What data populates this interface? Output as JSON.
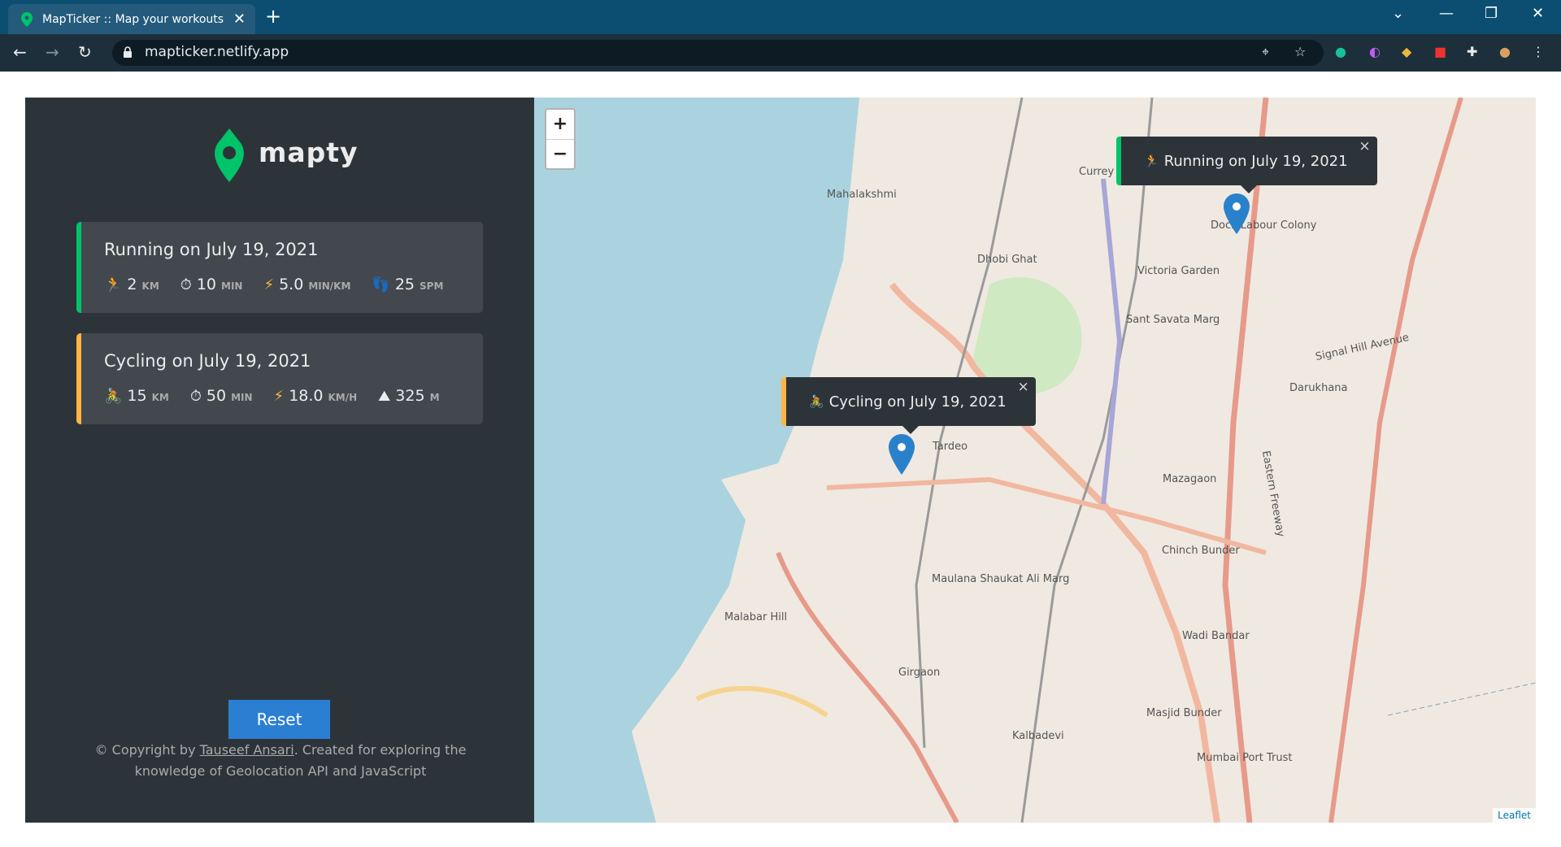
{
  "browser": {
    "tab_title": "MapTicker :: Map your workouts",
    "url": "mapticker.netlify.app"
  },
  "sidebar": {
    "brand": "mapty",
    "workouts": [
      {
        "title": "Running on July 19, 2021",
        "type": "running",
        "accent": "#00c46a",
        "stats": [
          {
            "icon": "running-icon",
            "value": "2",
            "unit": "KM"
          },
          {
            "icon": "stopwatch-icon",
            "value": "10",
            "unit": "MIN"
          },
          {
            "icon": "lightning-icon",
            "value": "5.0",
            "unit": "MIN/KM"
          },
          {
            "icon": "footprint-icon",
            "value": "25",
            "unit": "SPM"
          }
        ]
      },
      {
        "title": "Cycling on July 19, 2021",
        "type": "cycling",
        "accent": "#ffb545",
        "stats": [
          {
            "icon": "cycling-icon",
            "value": "15",
            "unit": "KM"
          },
          {
            "icon": "stopwatch-icon",
            "value": "50",
            "unit": "MIN"
          },
          {
            "icon": "lightning-icon",
            "value": "18.0",
            "unit": "KM/H"
          },
          {
            "icon": "mountain-icon",
            "value": "325",
            "unit": "M"
          }
        ]
      }
    ],
    "reset_label": "Reset",
    "copyright_prefix": "© Copyright by ",
    "copyright_author": "Tauseef Ansari",
    "copyright_suffix": ". Created for exploring the knowledge of Geolocation API and JavaScript"
  },
  "map": {
    "zoom_in": "+",
    "zoom_out": "−",
    "popups": [
      {
        "title": "Running on July 19, 2021",
        "close": "×"
      },
      {
        "title": "Cycling on July 19, 2021",
        "close": "×"
      }
    ],
    "attribution": "Leaflet",
    "labels": [
      "Mahalakshmi",
      "Dhobi Ghat",
      "Victoria Garden",
      "Sant Savata Marg",
      "Darukhana",
      "Mazagaon",
      "Tardeo",
      "Maulana Shaukat Ali Marg",
      "Malabar Hill",
      "Girgaon",
      "Kalbadevi",
      "Wadi Bandar",
      "Masjid Bunder",
      "Mumbai Port Trust",
      "Chinch Bunder",
      "Currey",
      "Signal Hill Avenue",
      "Eastern Freeway",
      "Dock Labour Colony"
    ]
  }
}
